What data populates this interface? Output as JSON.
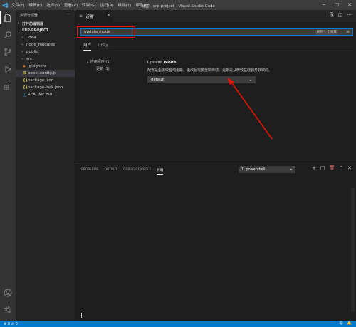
{
  "titlebar": {
    "menus": [
      "文件(F)",
      "编辑(E)",
      "选择(S)",
      "查看(V)",
      "转到(G)",
      "运行(R)",
      "终端(T)",
      "帮助(H)"
    ],
    "title": "设置 - erp-project - Visual Studio Code",
    "minimize": "─",
    "maximize": "☐",
    "close": "✕"
  },
  "sidebar": {
    "header": "资源管理器",
    "more": "···",
    "open_editors": "打开的编辑器",
    "project": "ERP-PROJECT",
    "items": [
      {
        "label": ".idea",
        "chevron": "›",
        "icon": ""
      },
      {
        "label": "node_modules",
        "chevron": "›",
        "icon": ""
      },
      {
        "label": "public",
        "chevron": "›",
        "icon": ""
      },
      {
        "label": "src",
        "chevron": "›",
        "icon": ""
      },
      {
        "label": ".gitignore",
        "chevron": "",
        "icon": "◆"
      },
      {
        "label": "babel.config.js",
        "chevron": "",
        "icon": "JS"
      },
      {
        "label": "package.json",
        "chevron": "",
        "icon": "{}"
      },
      {
        "label": "package-lock.json",
        "chevron": "",
        "icon": "{}"
      },
      {
        "label": "README.md",
        "chevron": "",
        "icon": "ⓘ"
      }
    ],
    "icon_colors": {
      "gitignore": "#e37933",
      "js": "#cbcb41",
      "json": "#cbcb41",
      "md": "#519aba"
    }
  },
  "editor": {
    "tab_icon": "≡",
    "tab_title": "设置",
    "tab_close": "✕",
    "actions": [
      "⎘",
      "◫",
      "···"
    ]
  },
  "settings": {
    "search_value": "update mode",
    "found": "找到 1 个设置",
    "filter_icon": "≡",
    "tabs": [
      "用户",
      "工作区"
    ],
    "toc": [
      "应用程序 (1)",
      "更新 (1)"
    ],
    "setting_prefix": "Update: ",
    "setting_name": "Mode",
    "setting_desc": "配置是否接收自动更新。更改后需要重新启动。更新是从微软在线服务获取的。",
    "setting_value": "default",
    "dropdown": "⌄"
  },
  "panel": {
    "tabs": [
      "PROBLEMS",
      "OUTPUT",
      "DEBUG CONSOLE",
      "终端"
    ],
    "terminal_select": "1: powershell",
    "dropdown": "⌄",
    "actions": [
      "+",
      "◫",
      "🗑",
      "⌃",
      "✕"
    ]
  },
  "status": {
    "left": "⊗ 0 ⚠ 0",
    "right_items": [
      "☺",
      "🔔"
    ]
  },
  "colors": {
    "accent": "#007acc",
    "annotation": "#e51400"
  }
}
